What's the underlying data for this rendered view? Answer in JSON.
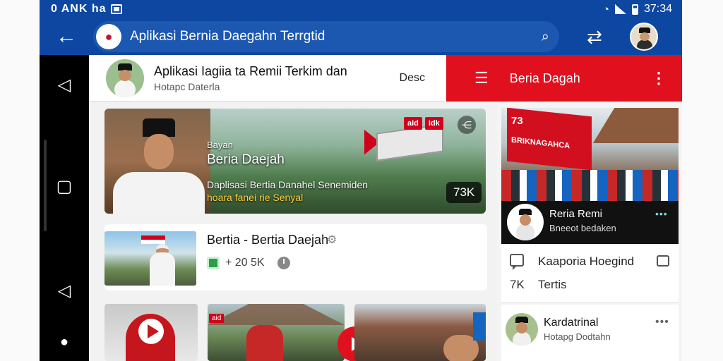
{
  "status_bar": {
    "left_text": "0 ANK ha",
    "time": "37:34",
    "wifi_icon": "wifi-icon",
    "signal_icon": "signal-icon",
    "battery_icon": "battery-icon"
  },
  "app_bar": {
    "back_icon": "back-arrow-icon",
    "title": "Aplikasi Bernia Daegahn Terrgtid",
    "search_icon": "search-icon",
    "share_icon": "share-icon",
    "colors": {
      "primary": "#0d47a1",
      "accent": "#e0101e"
    }
  },
  "nav_rail": {
    "items": [
      "back-icon",
      "home-icon",
      "back-icon",
      "person-icon"
    ]
  },
  "channel": {
    "title": "Aplikasi Iagiia ta Remii Terkim dan",
    "subtitle": "Hotapc Daterla",
    "desc_label": "Desc"
  },
  "red_bar": {
    "title": "Beria Dagah",
    "menu_icon": "menu-icon",
    "more_icon": "more-vert-icon"
  },
  "hero": {
    "kicker": "Bayan",
    "title": "Beria Daejah",
    "line1": "Daplisasi Bertia Danahel Senemiden",
    "line2": "hoara fanei rie Senyal",
    "views": "73K",
    "badges": [
      "aid",
      "idk"
    ]
  },
  "item": {
    "title": "Bertia - Bertia Daejah",
    "meta_count": "+ 20 5K"
  },
  "videos": [
    {
      "tag": "aid"
    },
    {
      "tag": ""
    }
  ],
  "side": {
    "banner_num": "73",
    "banner_text": "BRIKNAGAHCA",
    "host_name": "Reria Remi",
    "host_sub": "Bneeot bedaken",
    "host_dots": "•••",
    "comment_title": "Kaaporia Hoegind",
    "comment_count": "7K",
    "comment_label": "Tertis",
    "list_name": "Kardatrinal",
    "list_sub": "Hotapg Dodtahn",
    "list_more": "•••"
  }
}
